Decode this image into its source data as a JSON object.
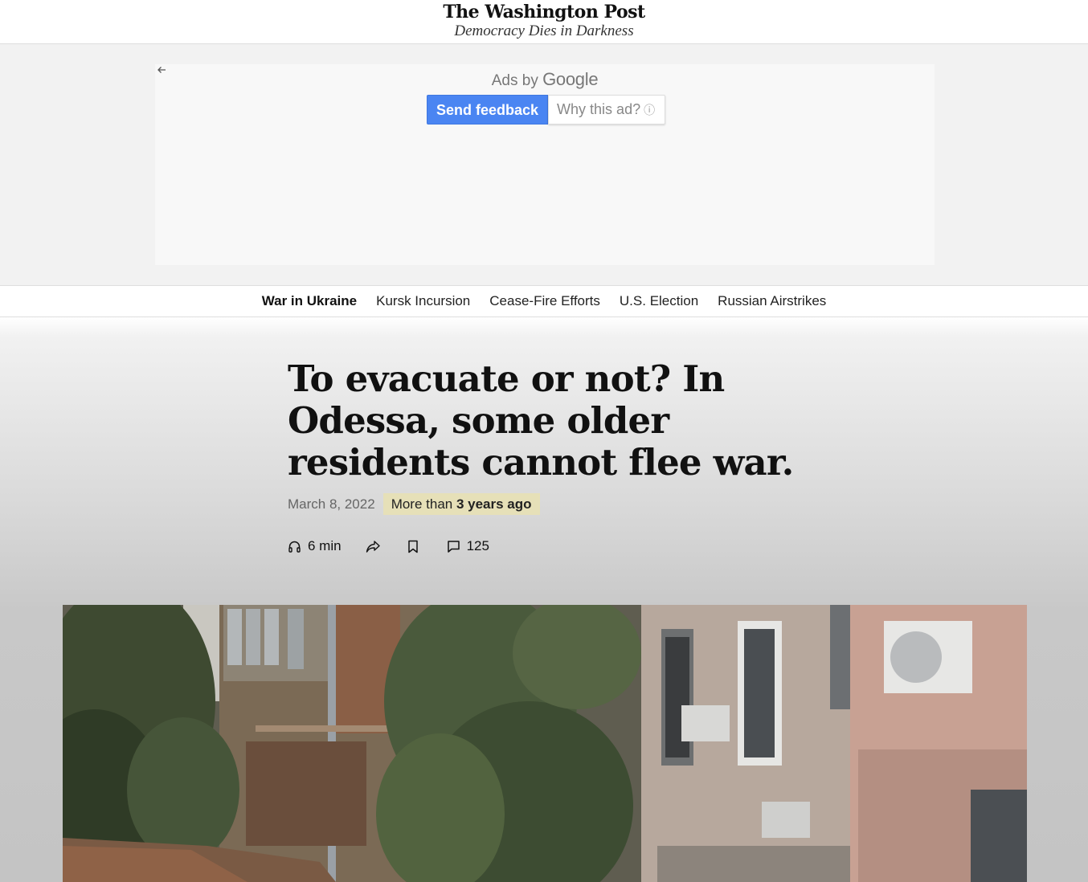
{
  "masthead": {
    "logo": "The Washington Post",
    "tagline": "Democracy Dies in Darkness"
  },
  "ad": {
    "ads_by": "Ads by",
    "google": "Google",
    "send_feedback": "Send feedback",
    "why_this_ad": "Why this ad?"
  },
  "nav": {
    "items": [
      {
        "label": "War in Ukraine"
      },
      {
        "label": "Kursk Incursion"
      },
      {
        "label": "Cease-Fire Efforts"
      },
      {
        "label": "U.S. Election"
      },
      {
        "label": "Russian Airstrikes"
      }
    ]
  },
  "article": {
    "headline": "To evacuate or not? In Odessa, some older residents cannot flee war.",
    "date": "March 8, 2022",
    "age_prefix": "More than",
    "age_bold": "3 years ago",
    "listen": "6 min",
    "comments": "125"
  },
  "icons": {
    "back": "arrow-left-icon",
    "info": "info-icon",
    "listen": "headphones-icon",
    "share": "share-icon",
    "save": "bookmark-icon",
    "comments": "comment-icon"
  },
  "colors": {
    "send_feedback_bg": "#4a85f2",
    "age_badge_bg": "#e6e0b8"
  }
}
